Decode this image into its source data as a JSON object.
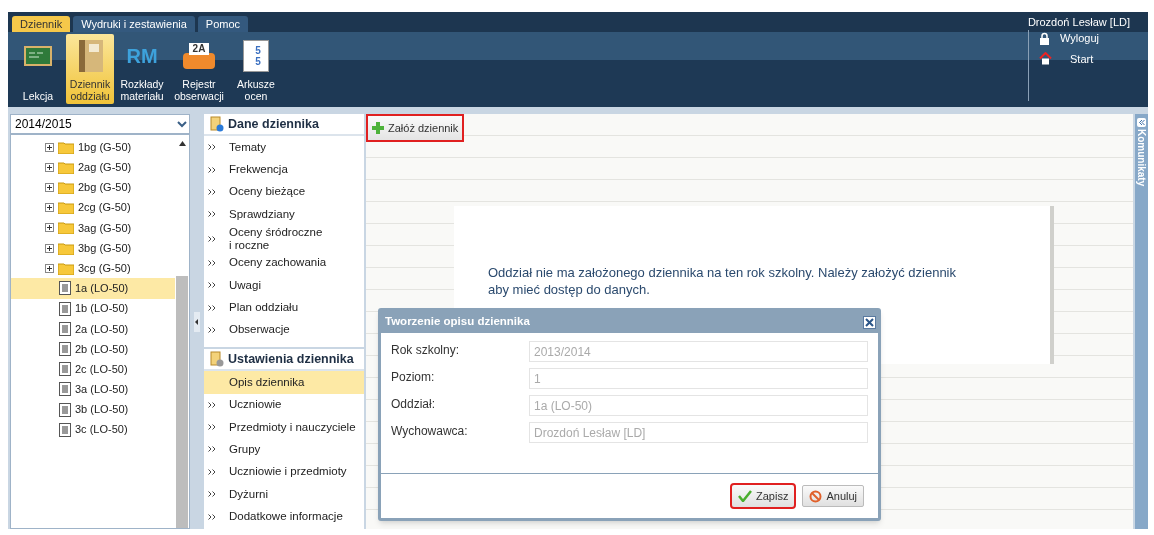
{
  "menu_tabs": [
    {
      "label": "Dziennik",
      "selected": true
    },
    {
      "label": "Wydruki i zestawienia",
      "selected": false
    },
    {
      "label": "Pomoc",
      "selected": false
    }
  ],
  "user": "Drozdoń Lesław [LD]",
  "ribbon": [
    {
      "kind": "board",
      "label": "Lekcja",
      "selected": false
    },
    {
      "kind": "book",
      "label": "Dziennik oddziału",
      "selected": true
    },
    {
      "kind": "rm",
      "label": "Rozkłady materiału",
      "selected": false,
      "icon_text": "RM"
    },
    {
      "kind": "folder",
      "label": "Rejestr obserwacji",
      "selected": false,
      "icon_text": "2A"
    },
    {
      "kind": "sheet",
      "label": "Arkusze ocen",
      "selected": false,
      "icon_text": "5\n5"
    }
  ],
  "session_links": [
    {
      "kind": "lock",
      "label": "Wyloguj"
    },
    {
      "kind": "home",
      "label": "Start"
    }
  ],
  "year_select": {
    "value": "2014/2015"
  },
  "tree": [
    {
      "kind": "folder",
      "label": "1bg (G-50)",
      "expanded": false,
      "selected": false
    },
    {
      "kind": "folder",
      "label": "2ag (G-50)",
      "expanded": false,
      "selected": false
    },
    {
      "kind": "folder",
      "label": "2bg (G-50)",
      "expanded": false,
      "selected": false
    },
    {
      "kind": "folder",
      "label": "2cg (G-50)",
      "expanded": false,
      "selected": false
    },
    {
      "kind": "folder",
      "label": "3ag (G-50)",
      "expanded": false,
      "selected": false
    },
    {
      "kind": "folder",
      "label": "3bg (G-50)",
      "expanded": false,
      "selected": false
    },
    {
      "kind": "folder",
      "label": "3cg (G-50)",
      "expanded": false,
      "selected": false
    },
    {
      "kind": "doc",
      "label": "1a (LO-50)",
      "selected": true
    },
    {
      "kind": "doc",
      "label": "1b (LO-50)",
      "selected": false
    },
    {
      "kind": "doc",
      "label": "2a (LO-50)",
      "selected": false
    },
    {
      "kind": "doc",
      "label": "2b (LO-50)",
      "selected": false
    },
    {
      "kind": "doc",
      "label": "2c (LO-50)",
      "selected": false
    },
    {
      "kind": "doc",
      "label": "3a (LO-50)",
      "selected": false
    },
    {
      "kind": "doc",
      "label": "3b (LO-50)",
      "selected": false
    },
    {
      "kind": "doc",
      "label": "3c (LO-50)",
      "selected": false
    }
  ],
  "sections": [
    {
      "kind": "data",
      "title": "Dane dziennika",
      "items": [
        {
          "label": "Tematy",
          "selected": false
        },
        {
          "label": "Frekwencja",
          "selected": false
        },
        {
          "label": "Oceny bieżące",
          "selected": false
        },
        {
          "label": "Sprawdziany",
          "selected": false
        },
        {
          "label": "Oceny śródroczne\ni roczne",
          "selected": false
        },
        {
          "label": "Oceny zachowania",
          "selected": false
        },
        {
          "label": "Uwagi",
          "selected": false
        },
        {
          "label": "Plan oddziału",
          "selected": false
        },
        {
          "label": "Obserwacje",
          "selected": false
        }
      ]
    },
    {
      "kind": "settings",
      "title": "Ustawienia dziennika",
      "items": [
        {
          "label": "Opis dziennika",
          "selected": true
        },
        {
          "label": "Uczniowie",
          "selected": false
        },
        {
          "label": "Przedmioty i nauczyciele",
          "selected": false
        },
        {
          "label": "Grupy",
          "selected": false
        },
        {
          "label": "Uczniowie i przedmioty",
          "selected": false
        },
        {
          "label": "Dyżurni",
          "selected": false
        },
        {
          "label": "Dodatkowe informacje",
          "selected": false
        }
      ]
    }
  ],
  "toolbar_button": {
    "label": "Załóż dziennik",
    "highlighted": true
  },
  "message": "Oddział nie ma założonego dziennika na ten rok szkolny. Należy założyć dziennik aby mieć dostęp do danych.",
  "side_panel": {
    "title": "Komunikaty"
  },
  "dialog": {
    "title": "Tworzenie opisu dziennika",
    "fields": [
      {
        "label": "Rok szkolny:",
        "value": "2013/2014",
        "disabled": true
      },
      {
        "label": "Poziom:",
        "value": "1",
        "disabled": true
      },
      {
        "label": "Oddział:",
        "value": "1a (LO-50)",
        "disabled": true
      },
      {
        "label": "Wychowawca:",
        "value": "Drozdoń Lesław [LD]",
        "disabled": true
      }
    ],
    "buttons": [
      {
        "kind": "save",
        "label": "Zapisz",
        "highlighted": true
      },
      {
        "kind": "cancel",
        "label": "Anuluj",
        "highlighted": false
      }
    ]
  }
}
